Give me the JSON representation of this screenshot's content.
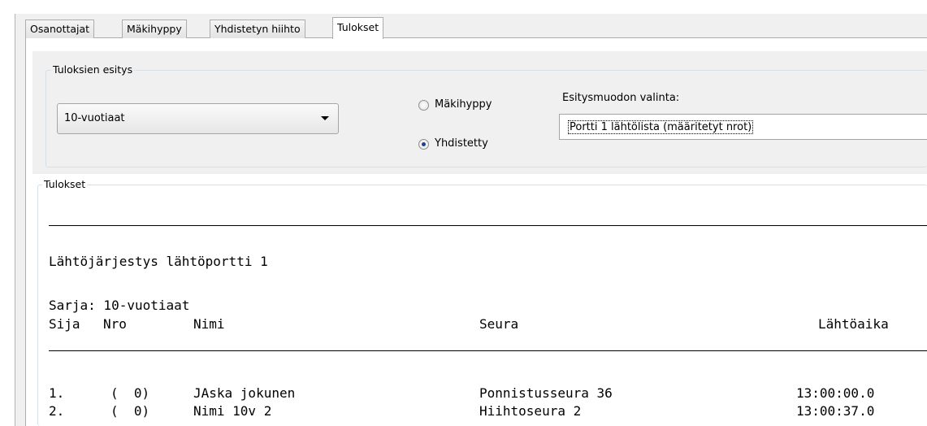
{
  "tabs": [
    {
      "label": "Osanottajat",
      "active": false
    },
    {
      "label": "Mäkihyppy",
      "active": false
    },
    {
      "label": "Yhdistetyn hiihto",
      "active": false
    },
    {
      "label": "Tulokset",
      "active": true
    }
  ],
  "display_group": {
    "legend": "Tuloksien esitys",
    "series_select": {
      "value": "10-vuotiaat"
    },
    "radio_makihyppy": {
      "label": "Mäkihyppy",
      "checked": false
    },
    "radio_yhdistetty": {
      "label": "Yhdistetty",
      "checked": true
    },
    "format_label": "Esitysmuodon valinta:",
    "format_selected": "Portti 1 lähtölista (määritetyt nrot)"
  },
  "results": {
    "legend": "Tulokset",
    "heading": "Lähtöjärjestys lähtöportti 1",
    "series_line": "Sarja: 10-vuotiaat",
    "columns": {
      "sija": "Sija",
      "nro": "Nro",
      "nimi": "Nimi",
      "seura": "Seura",
      "lahtoaika": "Lähtöaika"
    },
    "rows": [
      {
        "sija": "1.",
        "nro": "(  0)",
        "nimi": "JAska jokunen",
        "seura": "Ponnistusseura 36",
        "lahtoaika": "13:00:00.0"
      },
      {
        "sija": "2.",
        "nro": "(  0)",
        "nimi": "Nimi 10v 2",
        "seura": "Hiihtoseura 2",
        "lahtoaika": "13:00:37.0"
      }
    ]
  },
  "colors": {
    "window_bg": "#f0f0f0",
    "radio_dot": "#1c3f95",
    "border": "#adadad"
  }
}
